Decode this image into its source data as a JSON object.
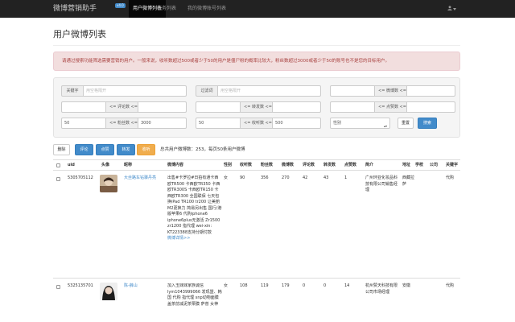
{
  "navbar": {
    "brand": "微博营销助手",
    "badge": "v4.0",
    "items": [
      {
        "label": "用户微博列表",
        "active": true
      },
      {
        "label": "任务列表",
        "active": false
      },
      {
        "label": "我的微博账号列表",
        "active": false
      }
    ],
    "user_icon": "user-icon"
  },
  "page": {
    "title": "用户微博列表",
    "alert": "请通过搜索功能筛选需要营销的用户。一般来说，收听数超过500或者少于50的用户是僵尸粉的概率比较大，粉丝数超过3000或者少于50的账号也不是您的目标用户。"
  },
  "filters": {
    "keyword_label": "关键字",
    "keyword_placeholder": "用空格隔开",
    "filter_label": "过滤词",
    "filter_placeholder": "用空格隔开",
    "weibo_count_label": "<= 微博数 <=",
    "comment_count_label": "<= 评论数 <=",
    "repost_count_label": "<= 转发数 <=",
    "like_count_label": "<= 点赞数 <=",
    "fans_label": "<= 粉丝数 <=",
    "fans_min": "50",
    "fans_max": "3000",
    "follow_label": "<= 收听数 <=",
    "follow_min": "50",
    "follow_max": "500",
    "gender_select": "性别",
    "reset_button": "重置",
    "search_button": "搜索"
  },
  "toolbar": {
    "delete": "删除",
    "comment": "评论",
    "like": "点赞",
    "repost": "转发",
    "follow": "收听",
    "summary": "总共用户微博数：253，每页50条用户微博"
  },
  "table": {
    "headers": [
      "uid",
      "头像",
      "昵称",
      "微博内容",
      "性别",
      "收听数",
      "粉丝数",
      "微博数",
      "评论数",
      "转发数",
      "点赞数",
      "简介",
      "地址",
      "学校",
      "公司",
      "关键字"
    ],
    "rows": [
      {
        "uid": "5305705112",
        "nickname": "大丝路车钻骤丹亮",
        "content": "出售#卡罗拉#日拍有通卡西欧TR500 卡西欧TR350 卡西欧TR300S 卡西欧TR150 卡西欧TR300 全国联保 七天包换iPad TR100 tr200 让美丽M2更换力 简易另出售 国行/港版苹果6 代购iphone6 iphone6plus无激活 Zr1500 zr1200 指代理 wei-xin: KT223388支持分期付款",
        "more": "微博详情>>",
        "gender": "女",
        "follow": "90",
        "fans": "356",
        "weibo": "270",
        "comments": "42",
        "reposts": "43",
        "likes": "1",
        "bio": "广州环亚化妆品科技有限公司销售经理",
        "address": "西藏拉萨",
        "school": "",
        "company": "",
        "keyword": "代购"
      },
      {
        "uid": "5325135701",
        "nickname": "陈-薛山",
        "content": "加入玉妹妹家族诚信lym1043999066 发现盟、韩国 代购 指代理 snp动物面膜 盖茶前减泥茶栗膜 萨普 女神",
        "more": "",
        "gender": "女",
        "follow": "108",
        "fans": "119",
        "weibo": "179",
        "comments": "0",
        "reposts": "0",
        "likes": "14",
        "bio": "杭州赞天科技有限公司市场经理",
        "address": "安徽",
        "school": "",
        "company": "",
        "keyword": "代购"
      }
    ]
  },
  "colors": {
    "navbar_bg": "#222222",
    "primary": "#428bca",
    "warning": "#f0ad4e",
    "alert_text": "#a94442",
    "alert_bg": "#f2dede"
  }
}
